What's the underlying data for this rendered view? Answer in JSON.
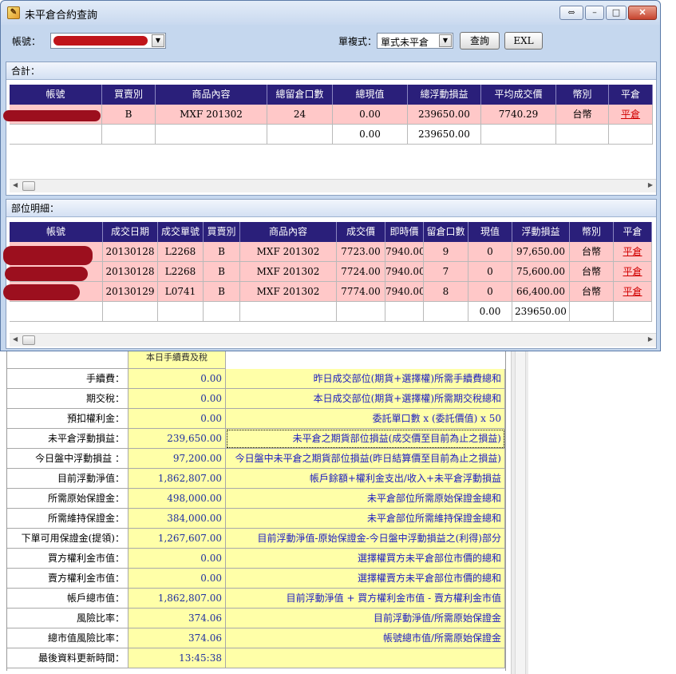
{
  "window": {
    "title": "未平倉合約查詢",
    "close": "✕",
    "min": "–",
    "max": "□",
    "pin": "⇔"
  },
  "toolbar": {
    "account_label": "帳號：",
    "mode_label": "單複式：",
    "mode_value": "單式未平倉",
    "query_label": "查詢",
    "exl_label": "EXL",
    "dd_arrow": "▼"
  },
  "summary": {
    "title": "合計：",
    "headers": [
      "帳號",
      "買賣別",
      "商品內容",
      "總留倉口數",
      "總現值",
      "總浮動損益",
      "平均成交價",
      "幣別",
      "平倉"
    ],
    "rows": [
      [
        "",
        "B",
        "MXF 201302",
        "24",
        "0.00",
        "239650.00",
        "7740.29",
        "台幣",
        "平倉"
      ],
      [
        "",
        "",
        "",
        "",
        "0.00",
        "239650.00",
        "",
        "",
        ""
      ]
    ]
  },
  "detail": {
    "title": "部位明細：",
    "headers": [
      "帳號",
      "成交日期",
      "成交單號",
      "買賣別",
      "商品內容",
      "成交價",
      "即時價",
      "留倉口數",
      "現值",
      "浮動損益",
      "幣別",
      "平倉"
    ],
    "rows": [
      [
        "",
        "20130128",
        "L2268",
        "B",
        "MXF 201302",
        "7723.00",
        "7940.00",
        "9",
        "0",
        "97,650.00",
        "台幣",
        "平倉"
      ],
      [
        "",
        "20130128",
        "L2268",
        "B",
        "MXF 201302",
        "7724.00",
        "7940.00",
        "7",
        "0",
        "75,600.00",
        "台幣",
        "平倉"
      ],
      [
        "",
        "20130129",
        "L0741",
        "B",
        "MXF 201302",
        "7774.00",
        "7940.00",
        "8",
        "0",
        "66,400.00",
        "台幣",
        "平倉"
      ],
      [
        "",
        "",
        "",
        "",
        "",
        "",
        "",
        "",
        "0.00",
        "239650.00",
        "",
        ""
      ]
    ]
  },
  "report": {
    "head": "本日手續費及稅",
    "rows": [
      {
        "label": "手續費：",
        "value": "0.00",
        "desc": "昨日成交部位(期貨+選擇權)所需手續費總和"
      },
      {
        "label": "期交稅：",
        "value": "0.00",
        "desc": "本日成交部位(期貨+選擇權)所需期交稅總和"
      },
      {
        "label": "預扣權利金：",
        "value": "0.00",
        "desc": "委託單口數 x (委託價值) x 50"
      },
      {
        "label": "未平倉浮動損益：",
        "value": "239,650.00",
        "desc": "未平倉之期貨部位損益(成交價至目前為止之損益)"
      },
      {
        "label": "今日盤中浮動損益 ：",
        "value": "97,200.00",
        "desc": "今日盤中未平倉之期貨部位損益(昨日結算價至目前為止之損益)"
      },
      {
        "label": "目前浮動淨值：",
        "value": "1,862,807.00",
        "desc": "帳戶餘額+權利金支出/收入+未平倉浮動損益"
      },
      {
        "label": "所需原始保證金：",
        "value": "498,000.00",
        "desc": "未平倉部位所需原始保證金總和"
      },
      {
        "label": "所需維持保證金：",
        "value": "384,000.00",
        "desc": "未平倉部位所需維持保證金總和"
      },
      {
        "label": "下單可用保證金(提領)：",
        "value": "1,267,607.00",
        "desc": "目前浮動淨值-原始保證金-今日盤中浮動損益之(利得)部分"
      },
      {
        "label": "買方權利金市值：",
        "value": "0.00",
        "desc": "選擇權買方未平倉部位市價的總和"
      },
      {
        "label": "賣方權利金市值：",
        "value": "0.00",
        "desc": "選擇權賣方未平倉部位市價的總和"
      },
      {
        "label": "帳戶總市值：",
        "value": "1,862,807.00",
        "desc": "目前浮動淨值 + 買方權利金市值 - 賣方權利金市值"
      },
      {
        "label": "風險比率：",
        "value": "374.06",
        "desc": "目前浮動淨值/所需原始保證金"
      },
      {
        "label": "總市值風險比率：",
        "value": "374.06",
        "desc": "帳號總市值/所需原始保證金"
      },
      {
        "label": "最後資料更新時間：",
        "value": "13:45:38",
        "desc": ""
      }
    ]
  }
}
